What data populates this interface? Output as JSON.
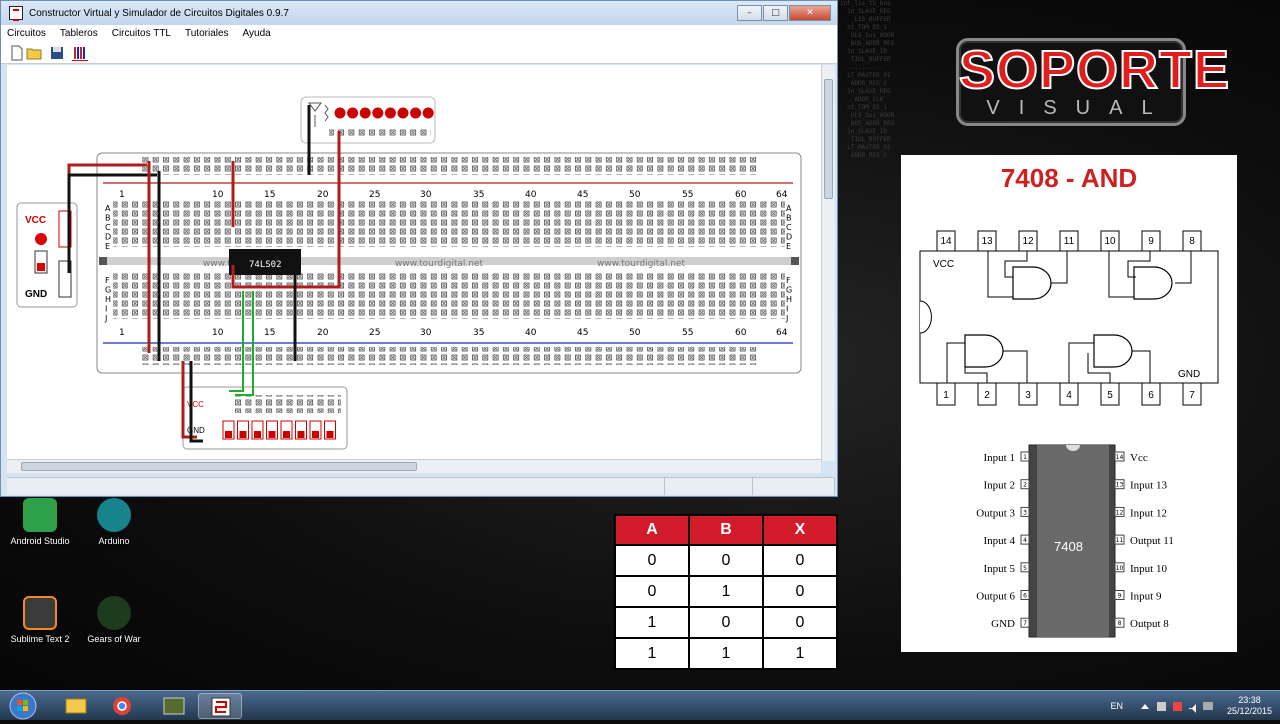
{
  "window": {
    "title": "Constructor Virtual y Simulador de Circuitos Digitales 0.9.7",
    "controls": {
      "minimize": "–",
      "maximize": "□",
      "close": "✕"
    }
  },
  "menu": [
    "Circuitos",
    "Tableros",
    "Circuitos TTL",
    "Tutoriales",
    "Ayuda"
  ],
  "breadboard": {
    "column_numbers": [
      "1",
      "10",
      "15",
      "20",
      "25",
      "30",
      "35",
      "40",
      "45",
      "50",
      "55",
      "60",
      "64"
    ],
    "rows_top": [
      "A",
      "B",
      "C",
      "D",
      "E"
    ],
    "rows_bottom": [
      "F",
      "G",
      "H",
      "I",
      "J"
    ],
    "watermark": "www.tourdigital.net",
    "chip_label": "74LS02",
    "power_vcc": "VCC",
    "power_gnd": "GND",
    "switch_vcc": "VCC",
    "switch_gnd": "GND"
  },
  "desktop_icons": [
    {
      "label": "Android Studio",
      "icon": "android-studio-icon"
    },
    {
      "label": "Arduino",
      "icon": "arduino-icon"
    },
    {
      "label": "Sublime Text 2",
      "icon": "sublime-text-icon"
    },
    {
      "label": "Gears of War",
      "icon": "gears-of-war-icon"
    }
  ],
  "logo": {
    "top": "SOPORTE",
    "bottom": "VISUAL"
  },
  "chip_diagram": {
    "title": "7408  - AND",
    "vcc": "VCC",
    "gnd": "GND",
    "top_pins": [
      "14",
      "13",
      "12",
      "11",
      "10",
      "9",
      "8"
    ],
    "bottom_pins": [
      "1",
      "2",
      "3",
      "4",
      "5",
      "6",
      "7"
    ],
    "ic_name": "7408",
    "left_pins": [
      {
        "label": "Input 1",
        "num": "1"
      },
      {
        "label": "Input 2",
        "num": "2"
      },
      {
        "label": "Output 3",
        "num": "3"
      },
      {
        "label": "Input 4",
        "num": "4"
      },
      {
        "label": "Input 5",
        "num": "5"
      },
      {
        "label": "Output 6",
        "num": "6"
      },
      {
        "label": "GND",
        "num": "7"
      }
    ],
    "right_pins": [
      {
        "label": "Vcc",
        "num": "14"
      },
      {
        "label": "Input 13",
        "num": "13"
      },
      {
        "label": "Input 12",
        "num": "12"
      },
      {
        "label": "Output 11",
        "num": "11"
      },
      {
        "label": "Input 10",
        "num": "10"
      },
      {
        "label": "Input 9",
        "num": "9"
      },
      {
        "label": "Output 8",
        "num": "8"
      }
    ]
  },
  "truth_table": {
    "headers": [
      "A",
      "B",
      "X"
    ],
    "rows": [
      [
        "0",
        "0",
        "0"
      ],
      [
        "0",
        "1",
        "0"
      ],
      [
        "1",
        "0",
        "0"
      ],
      [
        "1",
        "1",
        "1"
      ]
    ]
  },
  "taskbar": {
    "lang": "EN",
    "time": "23:38",
    "date": "25/12/2015"
  },
  "colors": {
    "accent_red": "#d21c2b",
    "wire_red": "#b01c1c",
    "wire_green": "#1fae2a",
    "bus_blue": "#1030c0"
  }
}
